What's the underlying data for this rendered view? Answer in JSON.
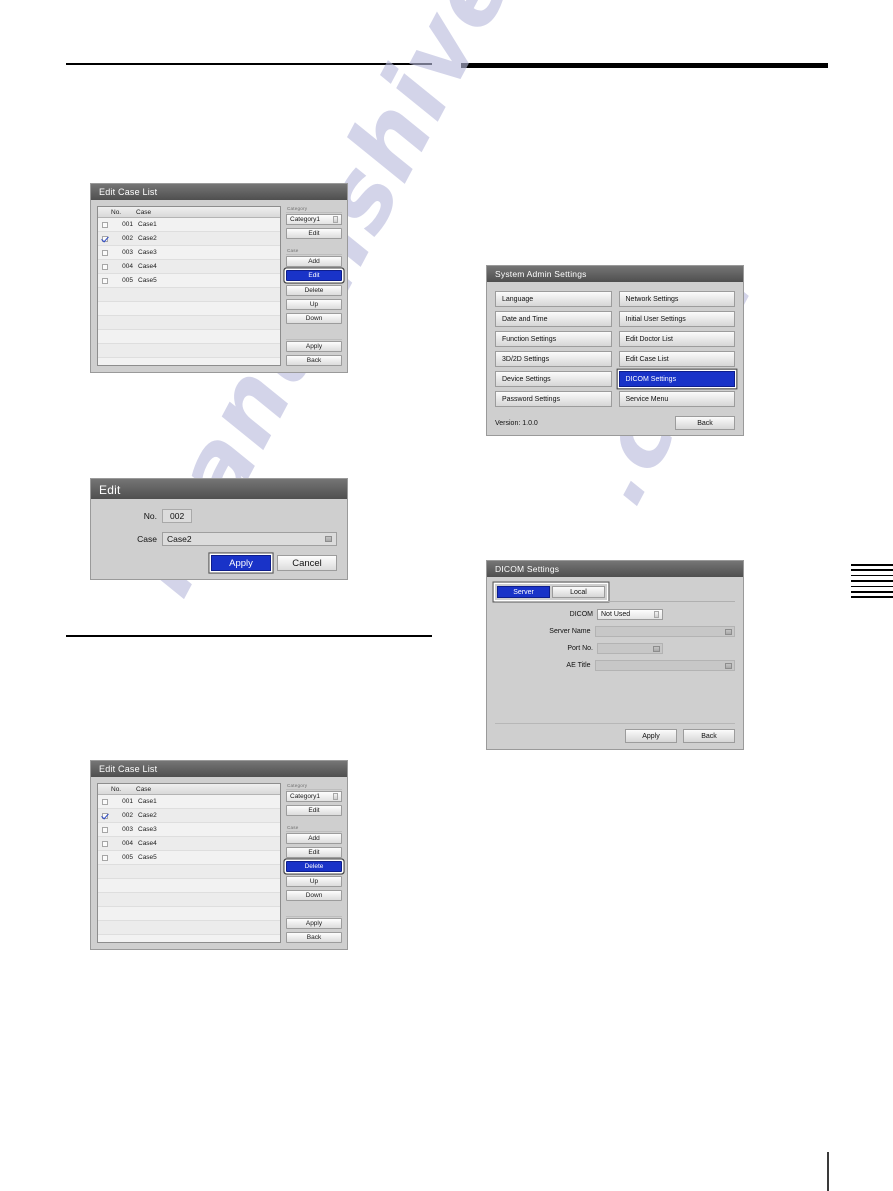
{
  "page": {
    "watermark_main": "manualshive",
    "watermark_dot": ".com"
  },
  "edit_case_list": {
    "title": "Edit Case List",
    "columns": {
      "no": "No.",
      "case": "Case"
    },
    "rows": [
      {
        "checked": false,
        "no": "001",
        "name": "Case1"
      },
      {
        "checked": true,
        "no": "002",
        "name": "Case2"
      },
      {
        "checked": false,
        "no": "003",
        "name": "Case3"
      },
      {
        "checked": false,
        "no": "004",
        "name": "Case4"
      },
      {
        "checked": false,
        "no": "005",
        "name": "Case5"
      }
    ],
    "category_group_label": "Category",
    "category_value": "Category1",
    "category_edit_label": "Edit",
    "case_group_label": "Case",
    "case_buttons": [
      "Add",
      "Edit",
      "Delete",
      "Up",
      "Down"
    ],
    "apply_label": "Apply",
    "back_label": "Back",
    "selected_case_button_top": "Edit",
    "selected_case_button_bottom": "Delete"
  },
  "edit_dialog": {
    "title": "Edit",
    "no_label": "No.",
    "no_value": "002",
    "case_label": "Case",
    "case_value": "Case2",
    "apply_label": "Apply",
    "cancel_label": "Cancel"
  },
  "system_admin_settings": {
    "title": "System Admin Settings",
    "buttons_left": [
      "Language",
      "Date and Time",
      "Function Settings",
      "3D/2D Settings",
      "Device Settings",
      "Password Settings"
    ],
    "buttons_right": [
      "Network Settings",
      "Initial User Settings",
      "Edit Doctor List",
      "Edit Case List",
      "DICOM Settings",
      "Service Menu"
    ],
    "selected_button": "DICOM Settings",
    "version": "Version: 1.0.0",
    "back_label": "Back"
  },
  "dicom_settings": {
    "title": "DICOM Settings",
    "tabs": [
      "Server",
      "Local"
    ],
    "active_tab": "Server",
    "fields": [
      {
        "label": "DICOM",
        "value": "Not Used",
        "type": "combo"
      },
      {
        "label": "Server Name",
        "value": "",
        "type": "input-wide"
      },
      {
        "label": "Port No.",
        "value": "",
        "type": "input-narrow"
      },
      {
        "label": "AE Title",
        "value": "",
        "type": "input-wide"
      }
    ],
    "apply_label": "Apply",
    "back_label": "Back"
  },
  "colors": {
    "accent_blue": "#1933c8",
    "dialog_face": "#cfcfcf",
    "title_bar": "#5f5f5f"
  }
}
